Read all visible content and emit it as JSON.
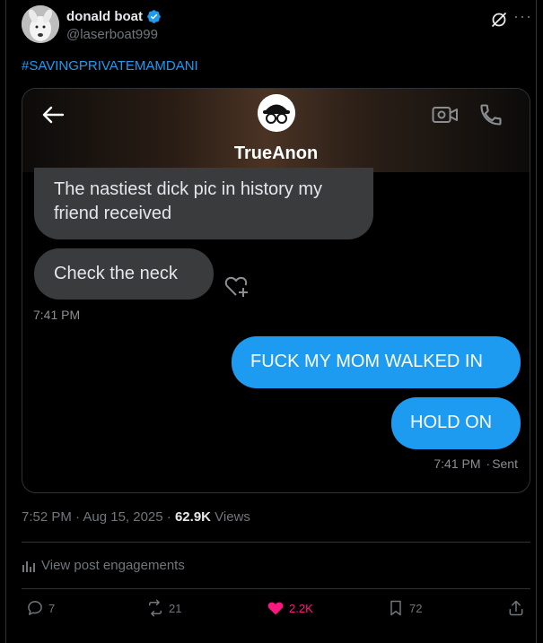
{
  "post": {
    "author": {
      "display_name": "donald boat",
      "handle": "@laserboat999",
      "verified": true
    },
    "text": "#SAVINGPRIVATEMAMDANI",
    "timestamp": "7:52 PM · Aug 15, 2025",
    "views_count": "62.9K",
    "views_label": "Views",
    "engagements_label": "View post engagements"
  },
  "dm": {
    "contact_name": "TrueAnon",
    "messages": [
      {
        "direction": "incoming",
        "text": "The nastiest dick pic in history my friend received"
      },
      {
        "direction": "incoming",
        "text": "Check the neck"
      },
      {
        "direction": "outgoing",
        "text": "FUCK MY MOM WALKED IN"
      },
      {
        "direction": "outgoing",
        "text": "HOLD ON"
      }
    ],
    "incoming_time": "7:41 PM",
    "outgoing_time": "7:41 PM",
    "outgoing_status": "Sent"
  },
  "actions": {
    "replies": "7",
    "reposts": "21",
    "likes": "2.2K",
    "bookmarks": "72"
  },
  "colors": {
    "accent": "#1d9bf0",
    "like": "#f91880",
    "incoming_bubble": "#3a3b3c",
    "background": "#000000"
  },
  "icons": [
    "verified-badge-icon",
    "grok-icon",
    "more-icon",
    "back-arrow-icon",
    "video-call-icon",
    "phone-icon",
    "add-reaction-icon",
    "analytics-bars-icon",
    "reply-icon",
    "repost-icon",
    "like-icon",
    "bookmark-icon",
    "share-icon"
  ]
}
